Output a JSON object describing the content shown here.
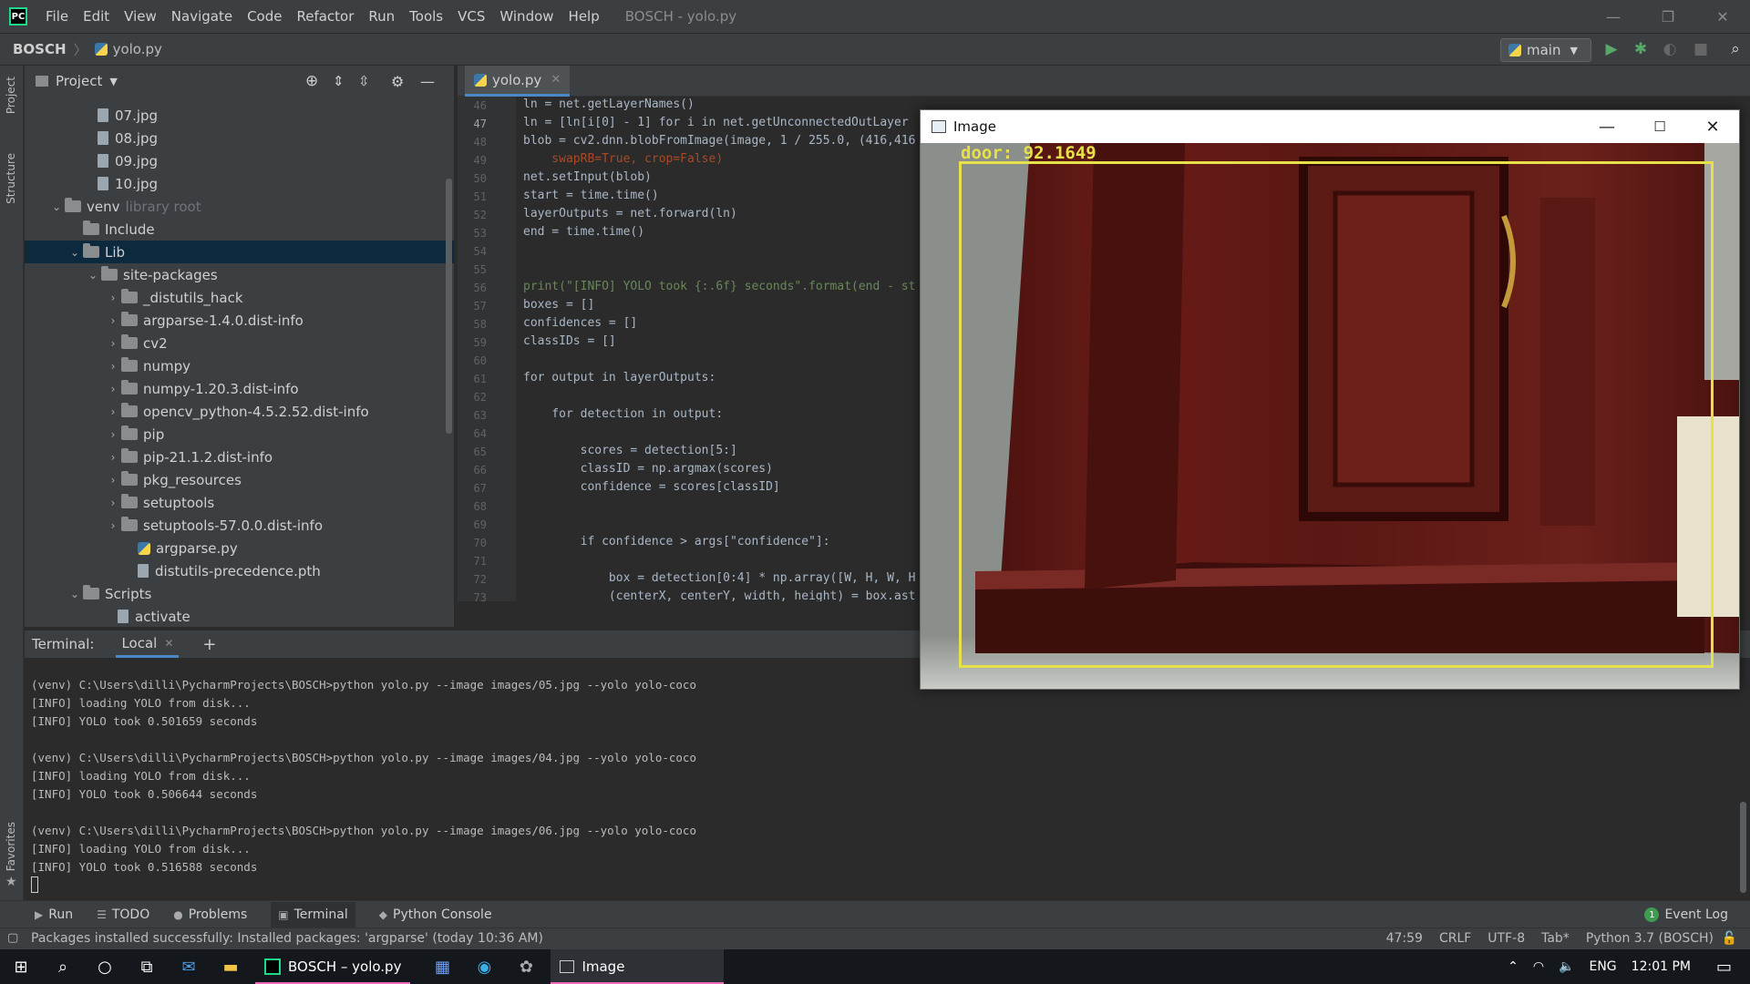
{
  "menubar": {
    "items": [
      "File",
      "Edit",
      "View",
      "Navigate",
      "Code",
      "Refactor",
      "Run",
      "Tools",
      "VCS",
      "Window",
      "Help"
    ],
    "window_title": "BOSCH - yolo.py",
    "controls": {
      "minimize": "—",
      "restore": "❐",
      "close": "✕"
    }
  },
  "navbar": {
    "project": "BOSCH",
    "file": "yolo.py",
    "run_config": "main"
  },
  "left_strip": {
    "project": "Project",
    "structure": "Structure",
    "favorites": "Favorites"
  },
  "project_panel": {
    "title": "Project",
    "tree": [
      {
        "label": "07.jpg",
        "type": "file"
      },
      {
        "label": "08.jpg",
        "type": "file"
      },
      {
        "label": "09.jpg",
        "type": "file"
      },
      {
        "label": "10.jpg",
        "type": "file"
      },
      {
        "label": "venv",
        "type": "folder",
        "open": true,
        "note": "library root"
      },
      {
        "label": "Include",
        "type": "folder"
      },
      {
        "label": "Lib",
        "type": "folder",
        "open": true,
        "selected": true
      },
      {
        "label": "site-packages",
        "type": "folder",
        "open": true
      },
      {
        "label": "_distutils_hack",
        "type": "folder"
      },
      {
        "label": "argparse-1.4.0.dist-info",
        "type": "folder"
      },
      {
        "label": "cv2",
        "type": "folder"
      },
      {
        "label": "numpy",
        "type": "folder"
      },
      {
        "label": "numpy-1.20.3.dist-info",
        "type": "folder"
      },
      {
        "label": "opencv_python-4.5.2.52.dist-info",
        "type": "folder"
      },
      {
        "label": "pip",
        "type": "folder"
      },
      {
        "label": "pip-21.1.2.dist-info",
        "type": "folder"
      },
      {
        "label": "pkg_resources",
        "type": "folder"
      },
      {
        "label": "setuptools",
        "type": "folder"
      },
      {
        "label": "setuptools-57.0.0.dist-info",
        "type": "folder"
      },
      {
        "label": "argparse.py",
        "type": "pyfile"
      },
      {
        "label": "distutils-precedence.pth",
        "type": "file"
      },
      {
        "label": "Scripts",
        "type": "folder",
        "open": true
      },
      {
        "label": "activate",
        "type": "file"
      }
    ]
  },
  "editor": {
    "tab": "yolo.py",
    "line_numbers": [
      "46",
      "47",
      "48",
      "49",
      "50",
      "51",
      "52",
      "53",
      "54",
      "55",
      "56",
      "57",
      "58",
      "59",
      "60",
      "61",
      "62",
      "63",
      "64",
      "65",
      "66",
      "67",
      "68",
      "69",
      "70",
      "71",
      "72",
      "73"
    ],
    "lines": [
      "ln = net.getLayerNames()",
      "ln = [ln[i[0] - 1] for i in net.getUnconnectedOutLayer",
      "blob = cv2.dnn.blobFromImage(image, 1 / 255.0, (416,416",
      "    swapRB=True, crop=False)",
      "net.setInput(blob)",
      "start = time.time()",
      "layerOutputs = net.forward(ln)",
      "end = time.time()",
      "",
      "",
      "print(\"[INFO] YOLO took {:.6f} seconds\".format(end - st",
      "boxes = []",
      "confidences = []",
      "classIDs = []",
      "",
      "for output in layerOutputs:",
      "",
      "    for detection in output:",
      "",
      "        scores = detection[5:]",
      "        classID = np.argmax(scores)",
      "        confidence = scores[classID]",
      "",
      "",
      "        if confidence > args[\"confidence\"]:",
      "",
      "            box = detection[0:4] * np.array([W, H, W, H",
      "            (centerX, centerY, width, height) = box.ast"
    ]
  },
  "image_window": {
    "title": "Image",
    "detection_label": "door: 92.1649",
    "box_color": "#e6e04a"
  },
  "terminal": {
    "label": "Terminal:",
    "tab": "Local",
    "lines": [
      "(venv) C:\\Users\\dilli\\PycharmProjects\\BOSCH>python yolo.py --image images/05.jpg --yolo yolo-coco",
      "[INFO] loading YOLO from disk...",
      "[INFO] YOLO took 0.501659 seconds",
      "",
      "(venv) C:\\Users\\dilli\\PycharmProjects\\BOSCH>python yolo.py --image images/04.jpg --yolo yolo-coco",
      "[INFO] loading YOLO from disk...",
      "[INFO] YOLO took 0.506644 seconds",
      "",
      "(venv) C:\\Users\\dilli\\PycharmProjects\\BOSCH>python yolo.py --image images/06.jpg --yolo yolo-coco",
      "[INFO] loading YOLO from disk...",
      "[INFO] YOLO took 0.516588 seconds"
    ]
  },
  "toolwindows": {
    "run": "Run",
    "todo": "TODO",
    "problems": "Problems",
    "terminal": "Terminal",
    "python_console": "Python Console",
    "event_log": "Event Log",
    "event_count": "1"
  },
  "statusbar": {
    "message": "Packages installed successfully: Installed packages: 'argparse' (today 10:36 AM)",
    "position": "47:59",
    "line_sep": "CRLF",
    "encoding": "UTF-8",
    "indent": "Tab*",
    "interpreter": "Python 3.7 (BOSCH)"
  },
  "taskbar": {
    "apps": [
      {
        "label": "BOSCH – yolo.py",
        "active": false
      },
      {
        "label": "Image",
        "active": true
      }
    ],
    "lang": "ENG",
    "time": "12:01 PM"
  }
}
